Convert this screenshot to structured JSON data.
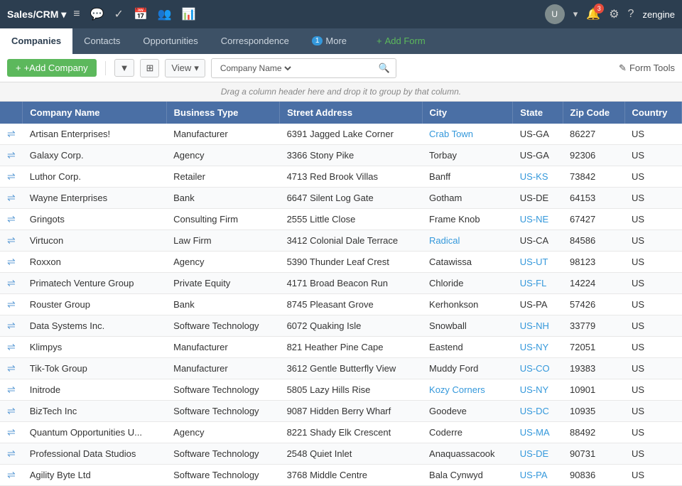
{
  "topNav": {
    "brand": "Sales/CRM ▾",
    "icons": [
      "≡",
      "💬",
      "✓",
      "📅",
      "👥",
      "📊"
    ],
    "notificationCount": "3",
    "userName": "zengine"
  },
  "subNav": {
    "tabs": [
      {
        "label": "Companies",
        "active": true
      },
      {
        "label": "Contacts",
        "active": false
      },
      {
        "label": "Opportunities",
        "active": false
      },
      {
        "label": "Correspondence",
        "active": false
      },
      {
        "label": "More",
        "active": false,
        "badge": "1"
      },
      {
        "label": "+ Add Form",
        "active": false,
        "isAdd": true
      }
    ]
  },
  "toolbar": {
    "addButton": "+Add Company",
    "viewLabel": "View",
    "searchByLabel": "Company Name",
    "searchPlaceholder": "",
    "formToolsLabel": "✎ Form Tools"
  },
  "groupBanner": "Drag a column header here and drop it to group by that column.",
  "tableHeaders": [
    "",
    "Company Name",
    "Business Type",
    "Street Address",
    "City",
    "State",
    "Zip Code",
    "Country"
  ],
  "tableRows": [
    {
      "company": "Artisan Enterprises!",
      "type": "Manufacturer",
      "street": "6391 Jagged Lake Corner",
      "city": "Crab Town",
      "cityLink": true,
      "state": "US-GA",
      "stateLink": false,
      "zip": "86227",
      "country": "US"
    },
    {
      "company": "Galaxy Corp.",
      "type": "Agency",
      "street": "3366 Stony Pike",
      "city": "Torbay",
      "cityLink": false,
      "state": "US-GA",
      "stateLink": false,
      "zip": "92306",
      "country": "US"
    },
    {
      "company": "Luthor Corp.",
      "type": "Retailer",
      "street": "4713 Red Brook Villas",
      "city": "Banff",
      "cityLink": false,
      "state": "US-KS",
      "stateLink": true,
      "zip": "73842",
      "country": "US"
    },
    {
      "company": "Wayne Enterprises",
      "type": "Bank",
      "street": "6647 Silent Log Gate",
      "city": "Gotham",
      "cityLink": false,
      "state": "US-DE",
      "stateLink": false,
      "zip": "64153",
      "country": "US"
    },
    {
      "company": "Gringots",
      "type": "Consulting Firm",
      "street": "2555 Little Close",
      "city": "Frame Knob",
      "cityLink": false,
      "state": "US-NE",
      "stateLink": true,
      "zip": "67427",
      "country": "US"
    },
    {
      "company": "Virtucon",
      "type": "Law Firm",
      "street": "3412 Colonial Dale Terrace",
      "city": "Radical",
      "cityLink": true,
      "state": "US-CA",
      "stateLink": false,
      "zip": "84586",
      "country": "US"
    },
    {
      "company": "Roxxon",
      "type": "Agency",
      "street": "5390 Thunder Leaf Crest",
      "city": "Catawissa",
      "cityLink": false,
      "state": "US-UT",
      "stateLink": true,
      "zip": "98123",
      "country": "US"
    },
    {
      "company": "Primatech Venture Group",
      "type": "Private Equity",
      "street": "4171 Broad Beacon Run",
      "city": "Chloride",
      "cityLink": false,
      "state": "US-FL",
      "stateLink": true,
      "zip": "14224",
      "country": "US"
    },
    {
      "company": "Rouster Group",
      "type": "Bank",
      "street": "8745 Pleasant Grove",
      "city": "Kerhonkson",
      "cityLink": false,
      "state": "US-PA",
      "stateLink": false,
      "zip": "57426",
      "country": "US"
    },
    {
      "company": "Data Systems Inc.",
      "type": "Software Technology",
      "street": "6072 Quaking Isle",
      "city": "Snowball",
      "cityLink": false,
      "state": "US-NH",
      "stateLink": true,
      "zip": "33779",
      "country": "US"
    },
    {
      "company": "Klimpys",
      "type": "Manufacturer",
      "street": "821 Heather Pine Cape",
      "city": "Eastend",
      "cityLink": false,
      "state": "US-NY",
      "stateLink": true,
      "zip": "72051",
      "country": "US"
    },
    {
      "company": "Tik-Tok Group",
      "type": "Manufacturer",
      "street": "3612 Gentle Butterfly View",
      "city": "Muddy Ford",
      "cityLink": false,
      "state": "US-CO",
      "stateLink": true,
      "zip": "19383",
      "country": "US"
    },
    {
      "company": "Initrode",
      "type": "Software Technology",
      "street": "5805 Lazy Hills Rise",
      "city": "Kozy Corners",
      "cityLink": true,
      "state": "US-NY",
      "stateLink": true,
      "zip": "10901",
      "country": "US"
    },
    {
      "company": "BizTech Inc",
      "type": "Software Technology",
      "street": "9087 Hidden Berry Wharf",
      "city": "Goodeve",
      "cityLink": false,
      "state": "US-DC",
      "stateLink": true,
      "zip": "10935",
      "country": "US"
    },
    {
      "company": "Quantum Opportunities U...",
      "type": "Agency",
      "street": "8221 Shady Elk Crescent",
      "city": "Coderre",
      "cityLink": false,
      "state": "US-MA",
      "stateLink": true,
      "zip": "88492",
      "country": "US"
    },
    {
      "company": "Professional Data Studios",
      "type": "Software Technology",
      "street": "2548 Quiet Inlet",
      "city": "Anaquassacook",
      "cityLink": false,
      "state": "US-DE",
      "stateLink": true,
      "zip": "90731",
      "country": "US"
    },
    {
      "company": "Agility Byte Ltd",
      "type": "Software Technology",
      "street": "3768 Middle Centre",
      "city": "Bala Cynwyd",
      "cityLink": false,
      "state": "US-PA",
      "stateLink": true,
      "zip": "90836",
      "country": "US"
    }
  ]
}
